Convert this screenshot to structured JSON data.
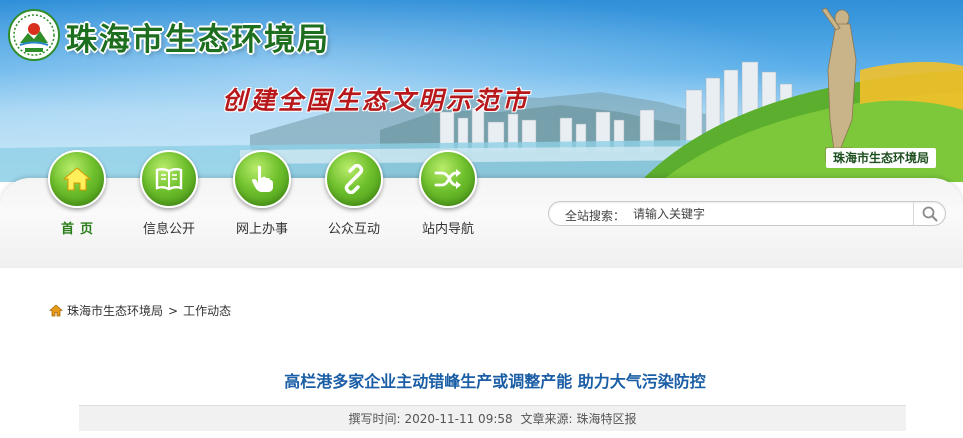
{
  "header": {
    "site_title": "珠海市生态环境局",
    "slogan": "创建全国生态文明示范市",
    "badge": "珠海市生态环境局",
    "logo_icon": "emblem-icon"
  },
  "nav": {
    "items": [
      {
        "label": "首页",
        "icon": "home-icon",
        "active": true
      },
      {
        "label": "信息公开",
        "icon": "book-icon",
        "active": false
      },
      {
        "label": "网上办事",
        "icon": "pointer-hand-icon",
        "active": false
      },
      {
        "label": "公众互动",
        "icon": "link-icon",
        "active": false
      },
      {
        "label": "站内导航",
        "icon": "shuffle-icon",
        "active": false
      }
    ]
  },
  "search": {
    "label": "全站搜索：",
    "placeholder": "请输入关键字",
    "icon": "search-icon"
  },
  "breadcrumb": {
    "home": "珠海市生态环境局",
    "separator": ">",
    "current": "工作动态"
  },
  "article": {
    "title": "高栏港多家企业主动错峰生产或调整产能 助力大气污染防控",
    "date_label": "撰写时间:",
    "date": "2020-11-11 09:58",
    "source_label": "文章来源:",
    "source": "珠海特区报"
  },
  "colors": {
    "brand_green": "#1d6e1e",
    "slogan_red": "#b7181b",
    "title_blue": "#1b5ea6",
    "nav_green": "#6fc02d"
  }
}
